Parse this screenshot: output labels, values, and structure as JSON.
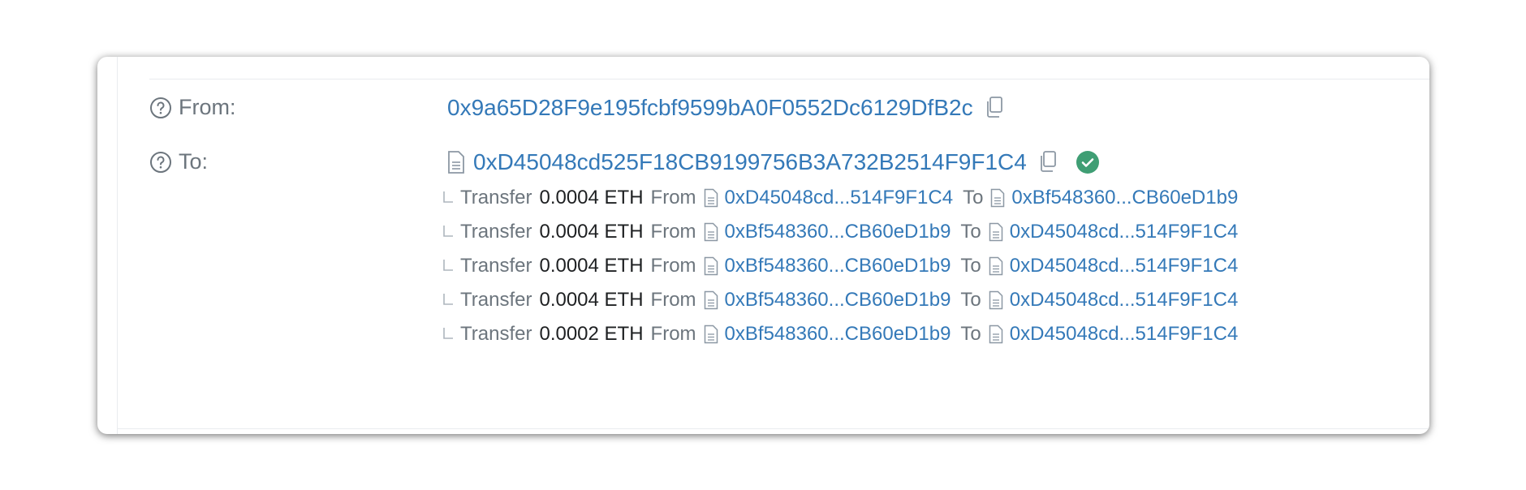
{
  "from": {
    "label": "From:",
    "address": "0x9a65D28F9e195fcbf9599bA0F0552Dc6129DfB2c"
  },
  "to": {
    "label": "To:",
    "address": "0xD45048cd525F18CB9199756B3A732B2514F9F1C4",
    "status_color": "#3f9e74"
  },
  "transfers": [
    {
      "action": "Transfer",
      "amount": "0.0004 ETH",
      "from_kw": "From",
      "from_addr": "0xD45048cd...514F9F1C4",
      "to_kw": "To",
      "to_addr": "0xBf548360...CB60eD1b9"
    },
    {
      "action": "Transfer",
      "amount": "0.0004 ETH",
      "from_kw": "From",
      "from_addr": "0xBf548360...CB60eD1b9",
      "to_kw": "To",
      "to_addr": "0xD45048cd...514F9F1C4"
    },
    {
      "action": "Transfer",
      "amount": "0.0004 ETH",
      "from_kw": "From",
      "from_addr": "0xBf548360...CB60eD1b9",
      "to_kw": "To",
      "to_addr": "0xD45048cd...514F9F1C4"
    },
    {
      "action": "Transfer",
      "amount": "0.0004 ETH",
      "from_kw": "From",
      "from_addr": "0xBf548360...CB60eD1b9",
      "to_kw": "To",
      "to_addr": "0xD45048cd...514F9F1C4"
    },
    {
      "action": "Transfer",
      "amount": "0.0002 ETH",
      "from_kw": "From",
      "from_addr": "0xBf548360...CB60eD1b9",
      "to_kw": "To",
      "to_addr": "0xD45048cd...514F9F1C4"
    }
  ],
  "colors": {
    "link": "#3479b8",
    "muted": "#6c757d",
    "success": "#3f9e74"
  }
}
